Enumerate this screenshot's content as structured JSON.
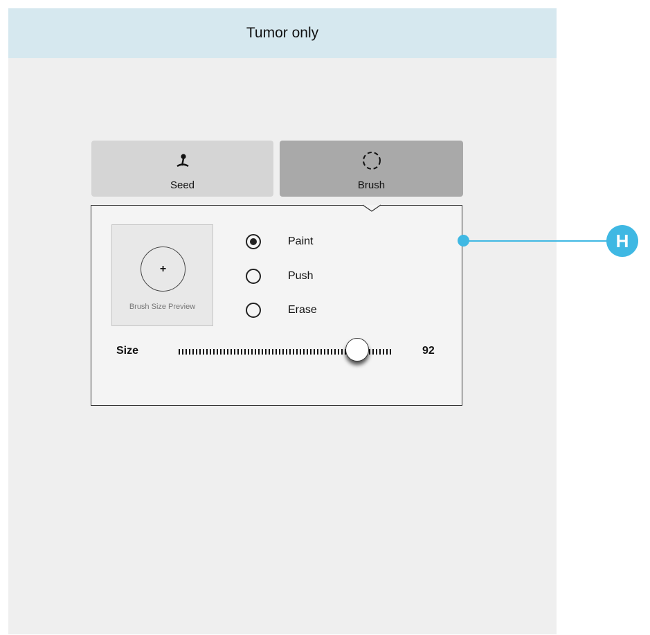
{
  "header": {
    "title": "Tumor only"
  },
  "tabs": [
    {
      "label": "Seed",
      "icon": "seed-icon",
      "selected": false
    },
    {
      "label": "Brush",
      "icon": "dashed-circle-icon",
      "selected": true
    }
  ],
  "brush_panel": {
    "preview": {
      "symbol": "+",
      "caption": "Brush Size Preview"
    },
    "modes": [
      {
        "label": "Paint",
        "selected": true
      },
      {
        "label": "Push",
        "selected": false
      },
      {
        "label": "Erase",
        "selected": false
      }
    ],
    "size": {
      "label": "Size",
      "value": "92",
      "fraction": 0.84
    }
  },
  "annotation": {
    "letter": "H",
    "color": "#3fb8e3"
  }
}
